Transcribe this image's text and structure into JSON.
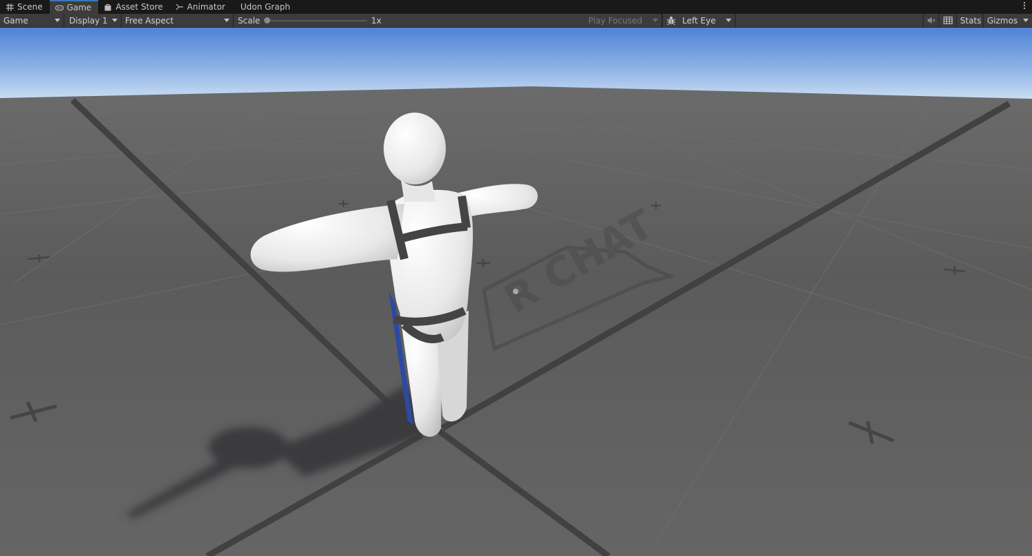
{
  "tabs": [
    {
      "label": "Scene",
      "icon": "grid-icon"
    },
    {
      "label": "Game",
      "icon": "gamepad-icon",
      "active": true
    },
    {
      "label": "Asset Store",
      "icon": "bag-icon"
    },
    {
      "label": "Animator",
      "icon": "animator-icon"
    },
    {
      "label": "Udon Graph",
      "icon": ""
    }
  ],
  "toolbar": {
    "view_mode": "Game",
    "display": "Display 1",
    "aspect": "Free Aspect",
    "scale_label": "Scale",
    "scale_value": "1x",
    "scale_level": 0,
    "play_mode": "Play Focused",
    "eye": "Left Eye",
    "stats_label": "Stats",
    "gizmos_label": "Gizmos"
  },
  "viewport": {
    "floor_logo_text": "R CHAT",
    "sky_top_color": "#4f82d6",
    "sky_horizon_color": "#cfe0f3",
    "floor_color": "#5e5e5f"
  }
}
